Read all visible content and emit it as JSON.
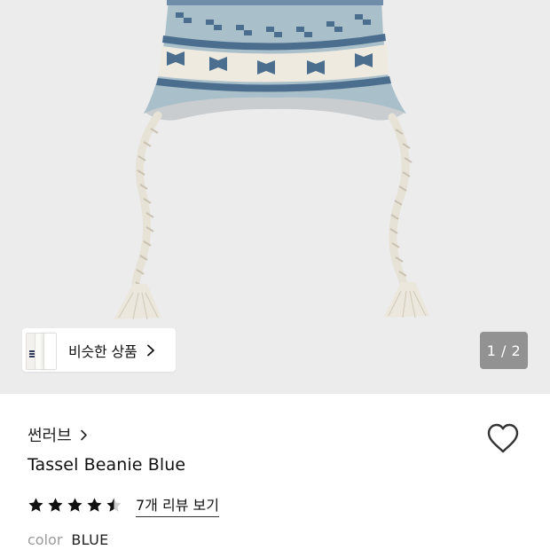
{
  "gallery": {
    "similar_label": "비슷한 상품",
    "page_indicator": "1 / 2"
  },
  "product": {
    "brand": "썬러브",
    "name": "Tassel Beanie Blue",
    "rating": 4.5,
    "review_link": "7개 리뷰 보기",
    "color_key": "color",
    "color_value": "BLUE"
  },
  "icons": {
    "similar_chevron": "chevron-right-icon",
    "brand_chevron": "chevron-right-icon",
    "wishlist": "heart-outline-icon",
    "star": "star-icon"
  },
  "colors": {
    "hero_bg": "#ececed",
    "knit_light": "#a9bfca",
    "knit_dark": "#4c6e8e",
    "knit_cream": "#efeae0"
  }
}
